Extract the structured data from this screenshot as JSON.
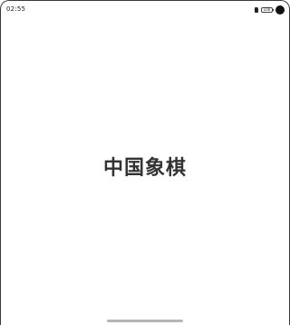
{
  "status_bar": {
    "time": "02:55",
    "battery_label": "100"
  },
  "app": {
    "title": "中国象棋"
  }
}
